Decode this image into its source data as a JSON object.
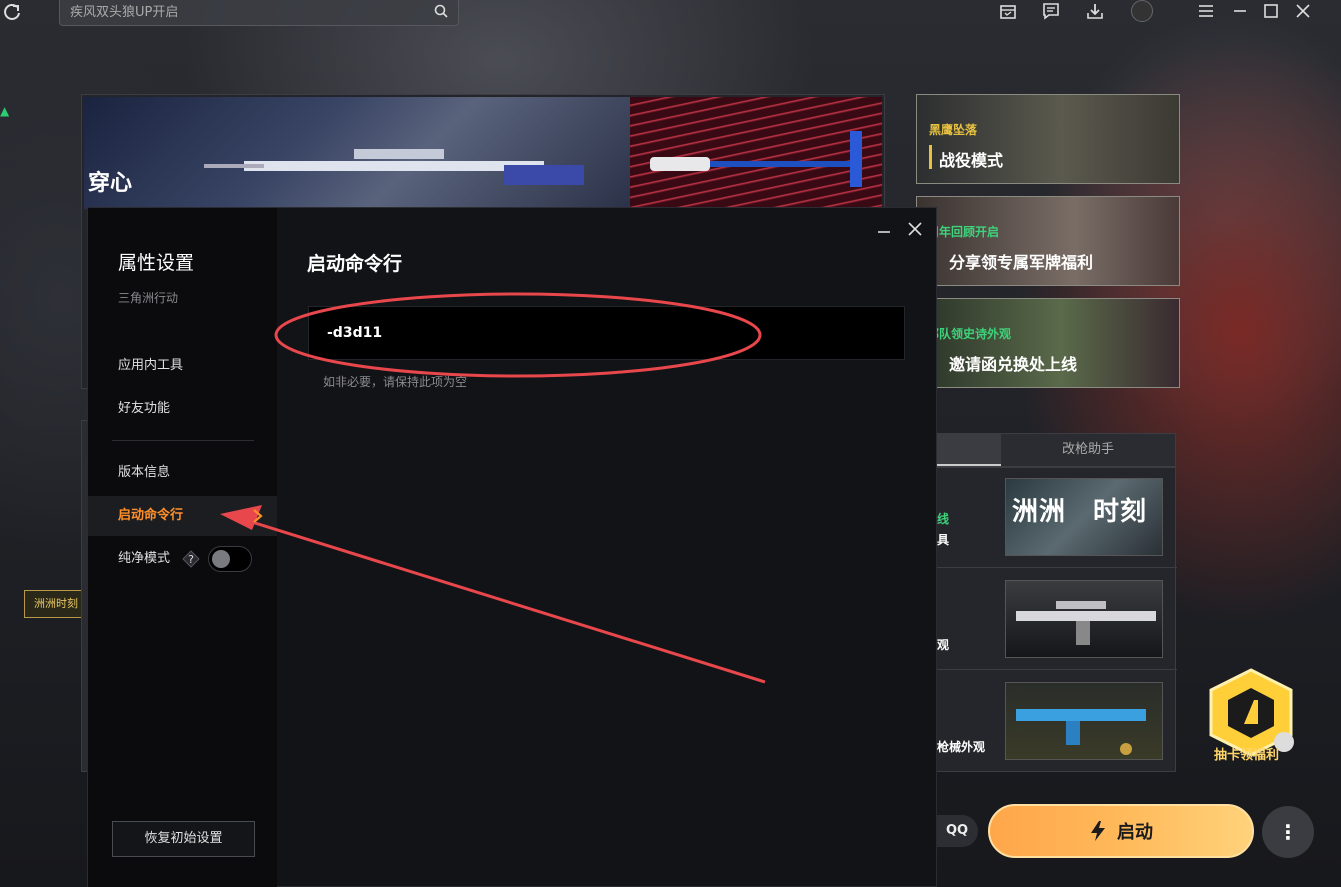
{
  "app": {
    "search_placeholder": "疾风双头狼UP开启",
    "top_icons": [
      "refresh-icon",
      "gift-box-icon",
      "message-icon",
      "download-icon",
      "avatar",
      "menu-icon",
      "minimize-icon",
      "maximize-icon",
      "close-icon"
    ]
  },
  "background": {
    "banner_title": "穿心",
    "left_tag": "洲洲时刻",
    "right_cards": [
      {
        "tag": "黑鹰坠落",
        "tag_color": "#e6c040",
        "title": "战役模式"
      },
      {
        "tag": "周年回顾开启",
        "tag_color": "#3ed27a",
        "title": "分享领专属军牌福利"
      },
      {
        "tag": "部队领史诗外观",
        "tag_color": "#3ed27a",
        "title": "邀请函兑换处上线"
      }
    ],
    "tabs": {
      "second": "改枪助手"
    },
    "list_items": [
      {
        "text_a": "线",
        "text_b": "具",
        "thumb_title": "洲洲时刻",
        "thumb_title_prefix": "洲洲",
        "thumb_title_suffix": "时刻"
      },
      {
        "text_a": "观",
        "text_b": ""
      },
      {
        "text_a": "枪械外观",
        "text_b": ""
      }
    ],
    "promo_label": "抽卡领福利",
    "qq_label": "QQ",
    "launch_label": "启动",
    "more_label": "⋮",
    "accent_color": "#ffa64a"
  },
  "dialog": {
    "title": "属性设置",
    "subtitle": "三角洲行动",
    "menu": {
      "tools": "应用内工具",
      "friends": "好友功能",
      "version": "版本信息",
      "launch_cmd": "启动命令行",
      "clean_mode": "纯净模式"
    },
    "clean_mode_on": false,
    "reset_label": "恢复初始设置",
    "content_title": "启动命令行",
    "cmd_value": "-d3d11",
    "hint": "如非必要，请保持此项为空",
    "active_color": "#ff8f2a"
  }
}
